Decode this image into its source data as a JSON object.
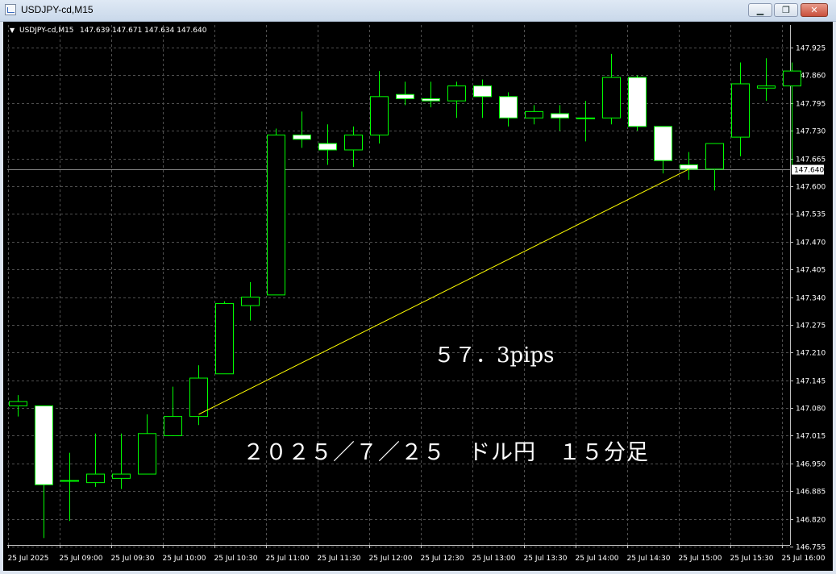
{
  "window": {
    "title": "USDJPY-cd,M15",
    "minimize_glyph": "▁",
    "maximize_glyph": "❐",
    "close_glyph": "✕"
  },
  "chart_header": {
    "dropdown_glyph": "▼",
    "symbol": "USDJPY-cd,M15",
    "ohlc": "147.639 147.671 147.634 147.640"
  },
  "colors": {
    "background": "#000000",
    "grid": "#505050",
    "bull_candle_fill": "#000000",
    "bear_candle_fill": "#ffffff",
    "candle_outline": "#00ff00",
    "trendline": "#ffff00",
    "price_line": "#888888",
    "text": "#ffffff"
  },
  "annotations": {
    "pips": "５７．3pips",
    "caption": "２０２５／７／２５　ドル円　１５分足"
  },
  "chart_data": {
    "type": "candlestick",
    "title": "USDJPY-cd,M15",
    "ylim": [
      146.755,
      147.925
    ],
    "y_ticks": [
      "147.925",
      "147.860",
      "147.795",
      "147.730",
      "147.665",
      "147.600",
      "147.535",
      "147.470",
      "147.405",
      "147.340",
      "147.275",
      "147.210",
      "147.145",
      "147.080",
      "147.015",
      "146.950",
      "146.885",
      "146.820",
      "146.755"
    ],
    "x_ticks": [
      "25 Jul 2025",
      "25 Jul 09:00",
      "25 Jul 09:30",
      "25 Jul 10:00",
      "25 Jul 10:30",
      "25 Jul 11:00",
      "25 Jul 11:30",
      "25 Jul 12:00",
      "25 Jul 12:30",
      "25 Jul 13:00",
      "25 Jul 13:30",
      "25 Jul 14:00",
      "25 Jul 14:30",
      "25 Jul 15:00",
      "25 Jul 15:30",
      "25 Jul 16:00"
    ],
    "current_price": "147.640",
    "candles": [
      {
        "o": 147.085,
        "h": 147.11,
        "l": 147.06,
        "c": 147.095
      },
      {
        "o": 147.085,
        "h": 147.085,
        "l": 146.775,
        "c": 146.9
      },
      {
        "o": 146.91,
        "h": 146.975,
        "l": 146.815,
        "c": 146.91
      },
      {
        "o": 146.905,
        "h": 147.02,
        "l": 146.895,
        "c": 146.925
      },
      {
        "o": 146.915,
        "h": 147.02,
        "l": 146.89,
        "c": 146.925
      },
      {
        "o": 146.925,
        "h": 147.065,
        "l": 146.925,
        "c": 147.02
      },
      {
        "o": 147.015,
        "h": 147.13,
        "l": 147.015,
        "c": 147.06
      },
      {
        "o": 147.06,
        "h": 147.18,
        "l": 147.04,
        "c": 147.15
      },
      {
        "o": 147.16,
        "h": 147.33,
        "l": 147.16,
        "c": 147.325
      },
      {
        "o": 147.32,
        "h": 147.375,
        "l": 147.285,
        "c": 147.34
      },
      {
        "o": 147.345,
        "h": 147.735,
        "l": 147.345,
        "c": 147.72
      },
      {
        "o": 147.72,
        "h": 147.775,
        "l": 147.69,
        "c": 147.71
      },
      {
        "o": 147.7,
        "h": 147.745,
        "l": 147.65,
        "c": 147.685
      },
      {
        "o": 147.685,
        "h": 147.74,
        "l": 147.645,
        "c": 147.72
      },
      {
        "o": 147.72,
        "h": 147.87,
        "l": 147.7,
        "c": 147.81
      },
      {
        "o": 147.815,
        "h": 147.845,
        "l": 147.79,
        "c": 147.805
      },
      {
        "o": 147.805,
        "h": 147.845,
        "l": 147.785,
        "c": 147.8
      },
      {
        "o": 147.8,
        "h": 147.845,
        "l": 147.76,
        "c": 147.835
      },
      {
        "o": 147.835,
        "h": 147.85,
        "l": 147.76,
        "c": 147.81
      },
      {
        "o": 147.81,
        "h": 147.82,
        "l": 147.74,
        "c": 147.76
      },
      {
        "o": 147.76,
        "h": 147.79,
        "l": 147.745,
        "c": 147.775
      },
      {
        "o": 147.77,
        "h": 147.79,
        "l": 147.73,
        "c": 147.76
      },
      {
        "o": 147.76,
        "h": 147.8,
        "l": 147.705,
        "c": 147.76
      },
      {
        "o": 147.76,
        "h": 147.91,
        "l": 147.745,
        "c": 147.855
      },
      {
        "o": 147.855,
        "h": 147.86,
        "l": 147.73,
        "c": 147.74
      },
      {
        "o": 147.74,
        "h": 147.74,
        "l": 147.63,
        "c": 147.66
      },
      {
        "o": 147.65,
        "h": 147.68,
        "l": 147.615,
        "c": 147.64
      },
      {
        "o": 147.64,
        "h": 147.7,
        "l": 147.59,
        "c": 147.7
      },
      {
        "o": 147.715,
        "h": 147.89,
        "l": 147.67,
        "c": 147.84
      },
      {
        "o": 147.83,
        "h": 147.9,
        "l": 147.8,
        "c": 147.835
      },
      {
        "o": 147.835,
        "h": 147.89,
        "l": 147.65,
        "c": 147.87
      }
    ],
    "trendline": {
      "from": {
        "x_index": 7,
        "y": 147.065
      },
      "to": {
        "x_index": 26,
        "y": 147.64
      }
    },
    "grid": true
  }
}
